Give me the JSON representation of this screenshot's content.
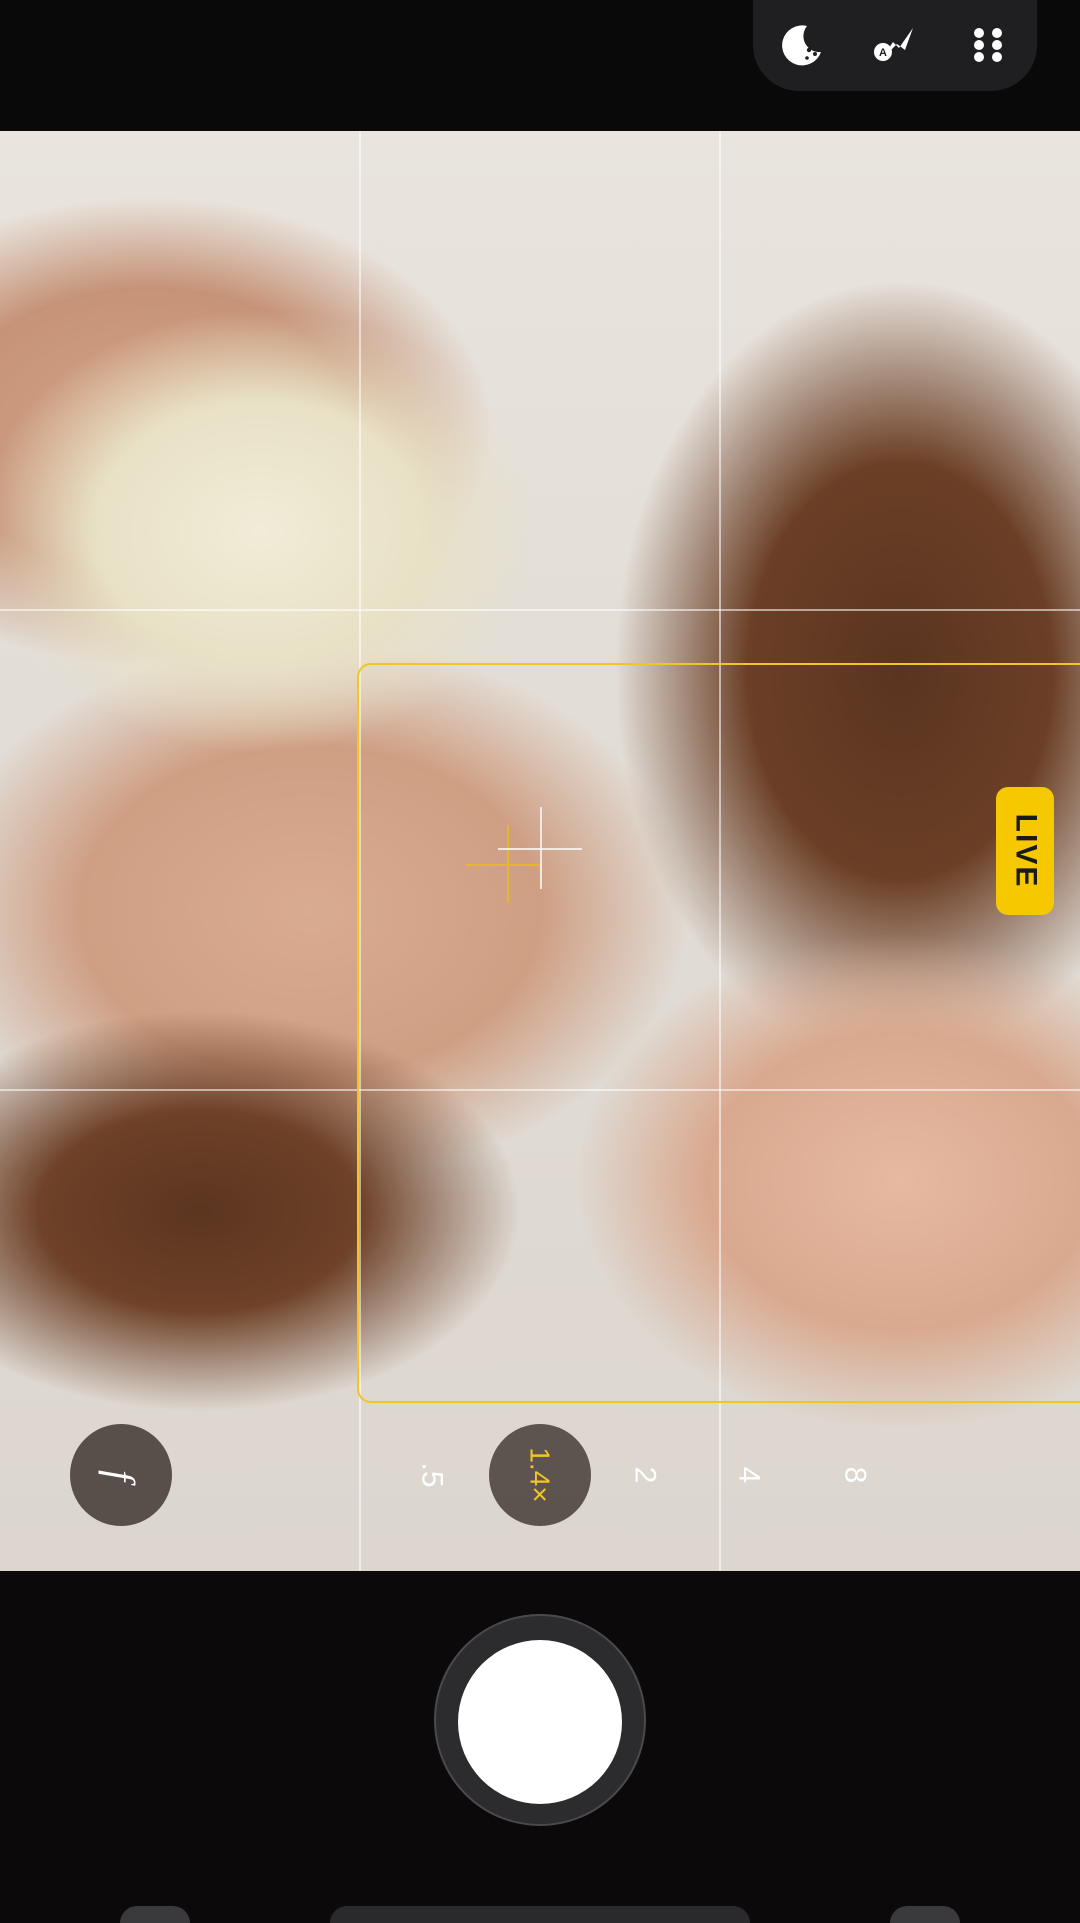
{
  "top_bar": {
    "icons": [
      "night-mode-icon",
      "flash-auto-icon",
      "more-options-icon"
    ]
  },
  "viewfinder": {
    "live_badge": "LIVE",
    "focus_box_color": "#f2c526"
  },
  "controls": {
    "aperture_label": "f",
    "zoom_levels": [
      ".5",
      "1.4×",
      "2",
      "4",
      "8"
    ],
    "active_zoom": "1.4×",
    "accent": "#f2c526"
  },
  "shutter": {
    "icon": "shutter-button"
  }
}
